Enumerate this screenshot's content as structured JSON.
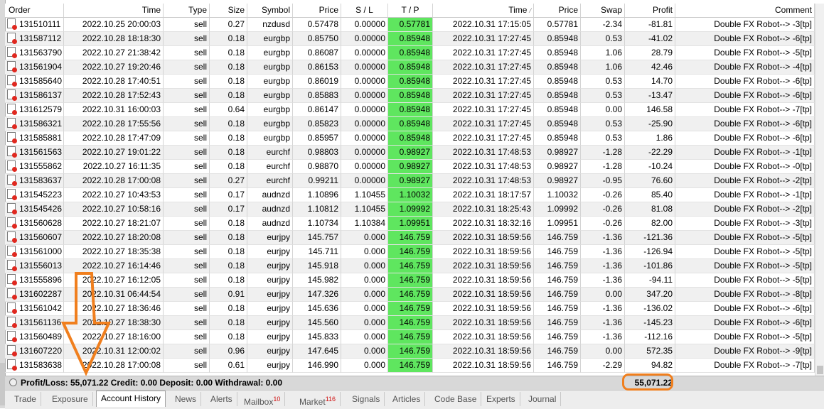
{
  "headers": {
    "order": "Order",
    "time": "Time",
    "type": "Type",
    "size": "Size",
    "symbol": "Symbol",
    "price": "Price",
    "sl": "S / L",
    "tp": "T / P",
    "close_time": "Time",
    "close_price": "Price",
    "swap": "Swap",
    "profit": "Profit",
    "comment": "Comment"
  },
  "rows": [
    {
      "order": "131510111",
      "time": "2022.10.25 20:00:03",
      "type": "sell",
      "size": "0.27",
      "symbol": "nzdusd",
      "price": "0.57478",
      "sl": "0.00000",
      "tp": "0.57781",
      "close_time": "2022.10.31 17:15:05",
      "close_price": "0.57781",
      "swap": "-2.34",
      "profit": "-81.81",
      "comment": "Double FX Robot--> -3[tp]"
    },
    {
      "order": "131587112",
      "time": "2022.10.28 18:18:30",
      "type": "sell",
      "size": "0.18",
      "symbol": "eurgbp",
      "price": "0.85750",
      "sl": "0.00000",
      "tp": "0.85948",
      "close_time": "2022.10.31 17:27:45",
      "close_price": "0.85948",
      "swap": "0.53",
      "profit": "-41.02",
      "comment": "Double FX Robot--> -6[tp]"
    },
    {
      "order": "131563790",
      "time": "2022.10.27 21:38:42",
      "type": "sell",
      "size": "0.18",
      "symbol": "eurgbp",
      "price": "0.86087",
      "sl": "0.00000",
      "tp": "0.85948",
      "close_time": "2022.10.31 17:27:45",
      "close_price": "0.85948",
      "swap": "1.06",
      "profit": "28.79",
      "comment": "Double FX Robot--> -5[tp]"
    },
    {
      "order": "131561904",
      "time": "2022.10.27 19:20:46",
      "type": "sell",
      "size": "0.18",
      "symbol": "eurgbp",
      "price": "0.86153",
      "sl": "0.00000",
      "tp": "0.85948",
      "close_time": "2022.10.31 17:27:45",
      "close_price": "0.85948",
      "swap": "1.06",
      "profit": "42.46",
      "comment": "Double FX Robot--> -4[tp]"
    },
    {
      "order": "131585640",
      "time": "2022.10.28 17:40:51",
      "type": "sell",
      "size": "0.18",
      "symbol": "eurgbp",
      "price": "0.86019",
      "sl": "0.00000",
      "tp": "0.85948",
      "close_time": "2022.10.31 17:27:45",
      "close_price": "0.85948",
      "swap": "0.53",
      "profit": "14.70",
      "comment": "Double FX Robot--> -6[tp]"
    },
    {
      "order": "131586137",
      "time": "2022.10.28 17:52:43",
      "type": "sell",
      "size": "0.18",
      "symbol": "eurgbp",
      "price": "0.85883",
      "sl": "0.00000",
      "tp": "0.85948",
      "close_time": "2022.10.31 17:27:45",
      "close_price": "0.85948",
      "swap": "0.53",
      "profit": "-13.47",
      "comment": "Double FX Robot--> -6[tp]"
    },
    {
      "order": "131612579",
      "time": "2022.10.31 16:00:03",
      "type": "sell",
      "size": "0.64",
      "symbol": "eurgbp",
      "price": "0.86147",
      "sl": "0.00000",
      "tp": "0.85948",
      "close_time": "2022.10.31 17:27:45",
      "close_price": "0.85948",
      "swap": "0.00",
      "profit": "146.58",
      "comment": "Double FX Robot--> -7[tp]"
    },
    {
      "order": "131586321",
      "time": "2022.10.28 17:55:56",
      "type": "sell",
      "size": "0.18",
      "symbol": "eurgbp",
      "price": "0.85823",
      "sl": "0.00000",
      "tp": "0.85948",
      "close_time": "2022.10.31 17:27:45",
      "close_price": "0.85948",
      "swap": "0.53",
      "profit": "-25.90",
      "comment": "Double FX Robot--> -6[tp]"
    },
    {
      "order": "131585881",
      "time": "2022.10.28 17:47:09",
      "type": "sell",
      "size": "0.18",
      "symbol": "eurgbp",
      "price": "0.85957",
      "sl": "0.00000",
      "tp": "0.85948",
      "close_time": "2022.10.31 17:27:45",
      "close_price": "0.85948",
      "swap": "0.53",
      "profit": "1.86",
      "comment": "Double FX Robot--> -6[tp]"
    },
    {
      "order": "131561563",
      "time": "2022.10.27 19:01:22",
      "type": "sell",
      "size": "0.18",
      "symbol": "eurchf",
      "price": "0.98803",
      "sl": "0.00000",
      "tp": "0.98927",
      "close_time": "2022.10.31 17:48:53",
      "close_price": "0.98927",
      "swap": "-1.28",
      "profit": "-22.29",
      "comment": "Double FX Robot--> -1[tp]"
    },
    {
      "order": "131555862",
      "time": "2022.10.27 16:11:35",
      "type": "sell",
      "size": "0.18",
      "symbol": "eurchf",
      "price": "0.98870",
      "sl": "0.00000",
      "tp": "0.98927",
      "close_time": "2022.10.31 17:48:53",
      "close_price": "0.98927",
      "swap": "-1.28",
      "profit": "-10.24",
      "comment": "Double FX Robot--> -0[tp]"
    },
    {
      "order": "131583637",
      "time": "2022.10.28 17:00:08",
      "type": "sell",
      "size": "0.27",
      "symbol": "eurchf",
      "price": "0.99211",
      "sl": "0.00000",
      "tp": "0.98927",
      "close_time": "2022.10.31 17:48:53",
      "close_price": "0.98927",
      "swap": "-0.95",
      "profit": "76.60",
      "comment": "Double FX Robot--> -2[tp]"
    },
    {
      "order": "131545223",
      "time": "2022.10.27 10:43:53",
      "type": "sell",
      "size": "0.17",
      "symbol": "audnzd",
      "price": "1.10896",
      "sl": "1.10455",
      "tp": "1.10032",
      "close_time": "2022.10.31 18:17:57",
      "close_price": "1.10032",
      "swap": "-0.26",
      "profit": "85.40",
      "comment": "Double FX Robot--> -1[tp]"
    },
    {
      "order": "131545426",
      "time": "2022.10.27 10:58:16",
      "type": "sell",
      "size": "0.17",
      "symbol": "audnzd",
      "price": "1.10812",
      "sl": "1.10455",
      "tp": "1.09992",
      "close_time": "2022.10.31 18:25:43",
      "close_price": "1.09992",
      "swap": "-0.26",
      "profit": "81.08",
      "comment": "Double FX Robot--> -2[tp]"
    },
    {
      "order": "131560628",
      "time": "2022.10.27 18:21:07",
      "type": "sell",
      "size": "0.18",
      "symbol": "audnzd",
      "price": "1.10734",
      "sl": "1.10384",
      "tp": "1.09951",
      "close_time": "2022.10.31 18:32:16",
      "close_price": "1.09951",
      "swap": "-0.26",
      "profit": "82.00",
      "comment": "Double FX Robot--> -3[tp]"
    },
    {
      "order": "131560607",
      "time": "2022.10.27 18:20:08",
      "type": "sell",
      "size": "0.18",
      "symbol": "eurjpy",
      "price": "145.757",
      "sl": "0.000",
      "tp": "146.759",
      "close_time": "2022.10.31 18:59:56",
      "close_price": "146.759",
      "swap": "-1.36",
      "profit": "-121.36",
      "comment": "Double FX Robot--> -5[tp]"
    },
    {
      "order": "131561000",
      "time": "2022.10.27 18:35:38",
      "type": "sell",
      "size": "0.18",
      "symbol": "eurjpy",
      "price": "145.711",
      "sl": "0.000",
      "tp": "146.759",
      "close_time": "2022.10.31 18:59:56",
      "close_price": "146.759",
      "swap": "-1.36",
      "profit": "-126.94",
      "comment": "Double FX Robot--> -5[tp]"
    },
    {
      "order": "131556013",
      "time": "2022.10.27 16:14:46",
      "type": "sell",
      "size": "0.18",
      "symbol": "eurjpy",
      "price": "145.918",
      "sl": "0.000",
      "tp": "146.759",
      "close_time": "2022.10.31 18:59:56",
      "close_price": "146.759",
      "swap": "-1.36",
      "profit": "-101.86",
      "comment": "Double FX Robot--> -5[tp]"
    },
    {
      "order": "131555896",
      "time": "2022.10.27 16:12:05",
      "type": "sell",
      "size": "0.18",
      "symbol": "eurjpy",
      "price": "145.982",
      "sl": "0.000",
      "tp": "146.759",
      "close_time": "2022.10.31 18:59:56",
      "close_price": "146.759",
      "swap": "-1.36",
      "profit": "-94.11",
      "comment": "Double FX Robot--> -5[tp]"
    },
    {
      "order": "131602287",
      "time": "2022.10.31 06:44:54",
      "type": "sell",
      "size": "0.91",
      "symbol": "eurjpy",
      "price": "147.326",
      "sl": "0.000",
      "tp": "146.759",
      "close_time": "2022.10.31 18:59:56",
      "close_price": "146.759",
      "swap": "0.00",
      "profit": "347.20",
      "comment": "Double FX Robot--> -8[tp]"
    },
    {
      "order": "131561042",
      "time": "2022.10.27 18:36:46",
      "type": "sell",
      "size": "0.18",
      "symbol": "eurjpy",
      "price": "145.636",
      "sl": "0.000",
      "tp": "146.759",
      "close_time": "2022.10.31 18:59:56",
      "close_price": "146.759",
      "swap": "-1.36",
      "profit": "-136.02",
      "comment": "Double FX Robot--> -6[tp]"
    },
    {
      "order": "131561136",
      "time": "2022.10.27 18:38:30",
      "type": "sell",
      "size": "0.18",
      "symbol": "eurjpy",
      "price": "145.560",
      "sl": "0.000",
      "tp": "146.759",
      "close_time": "2022.10.31 18:59:56",
      "close_price": "146.759",
      "swap": "-1.36",
      "profit": "-145.23",
      "comment": "Double FX Robot--> -6[tp]"
    },
    {
      "order": "131560489",
      "time": "2022.10.27 18:16:00",
      "type": "sell",
      "size": "0.18",
      "symbol": "eurjpy",
      "price": "145.833",
      "sl": "0.000",
      "tp": "146.759",
      "close_time": "2022.10.31 18:59:56",
      "close_price": "146.759",
      "swap": "-1.36",
      "profit": "-112.16",
      "comment": "Double FX Robot--> -5[tp]"
    },
    {
      "order": "131607220",
      "time": "2022.10.31 12:00:02",
      "type": "sell",
      "size": "0.96",
      "symbol": "eurjpy",
      "price": "147.645",
      "sl": "0.000",
      "tp": "146.759",
      "close_time": "2022.10.31 18:59:56",
      "close_price": "146.759",
      "swap": "0.00",
      "profit": "572.35",
      "comment": "Double FX Robot--> -9[tp]"
    },
    {
      "order": "131583638",
      "time": "2022.10.28 17:00:08",
      "type": "sell",
      "size": "0.61",
      "symbol": "eurjpy",
      "price": "146.990",
      "sl": "0.000",
      "tp": "146.759",
      "close_time": "2022.10.31 18:59:56",
      "close_price": "146.759",
      "swap": "-2.29",
      "profit": "94.82",
      "comment": "Double FX Robot--> -7[tp]"
    }
  ],
  "summary": {
    "text": "Profit/Loss: 55,071.22  Credit: 0.00  Deposit: 0.00  Withdrawal: 0.00",
    "total": "55,071.22"
  },
  "tabs": [
    {
      "label": "Trade",
      "badge": ""
    },
    {
      "label": "Exposure",
      "badge": ""
    },
    {
      "label": "Account History",
      "badge": ""
    },
    {
      "label": "News",
      "badge": ""
    },
    {
      "label": "Alerts",
      "badge": ""
    },
    {
      "label": "Mailbox",
      "badge": "10"
    },
    {
      "label": "Market",
      "badge": "116"
    },
    {
      "label": "Signals",
      "badge": ""
    },
    {
      "label": "Articles",
      "badge": ""
    },
    {
      "label": "Code Base",
      "badge": ""
    },
    {
      "label": "Experts",
      "badge": ""
    },
    {
      "label": "Journal",
      "badge": ""
    }
  ],
  "active_tab": "Account History",
  "colors": {
    "tp_highlight": "#5fe65f",
    "annotation": "#f07f1e",
    "loss_icon": "#e0281f"
  },
  "icons": {
    "order_row": "closed-order-icon",
    "sort": "sort-indicator-icon",
    "summary": "summary-circle-icon"
  }
}
